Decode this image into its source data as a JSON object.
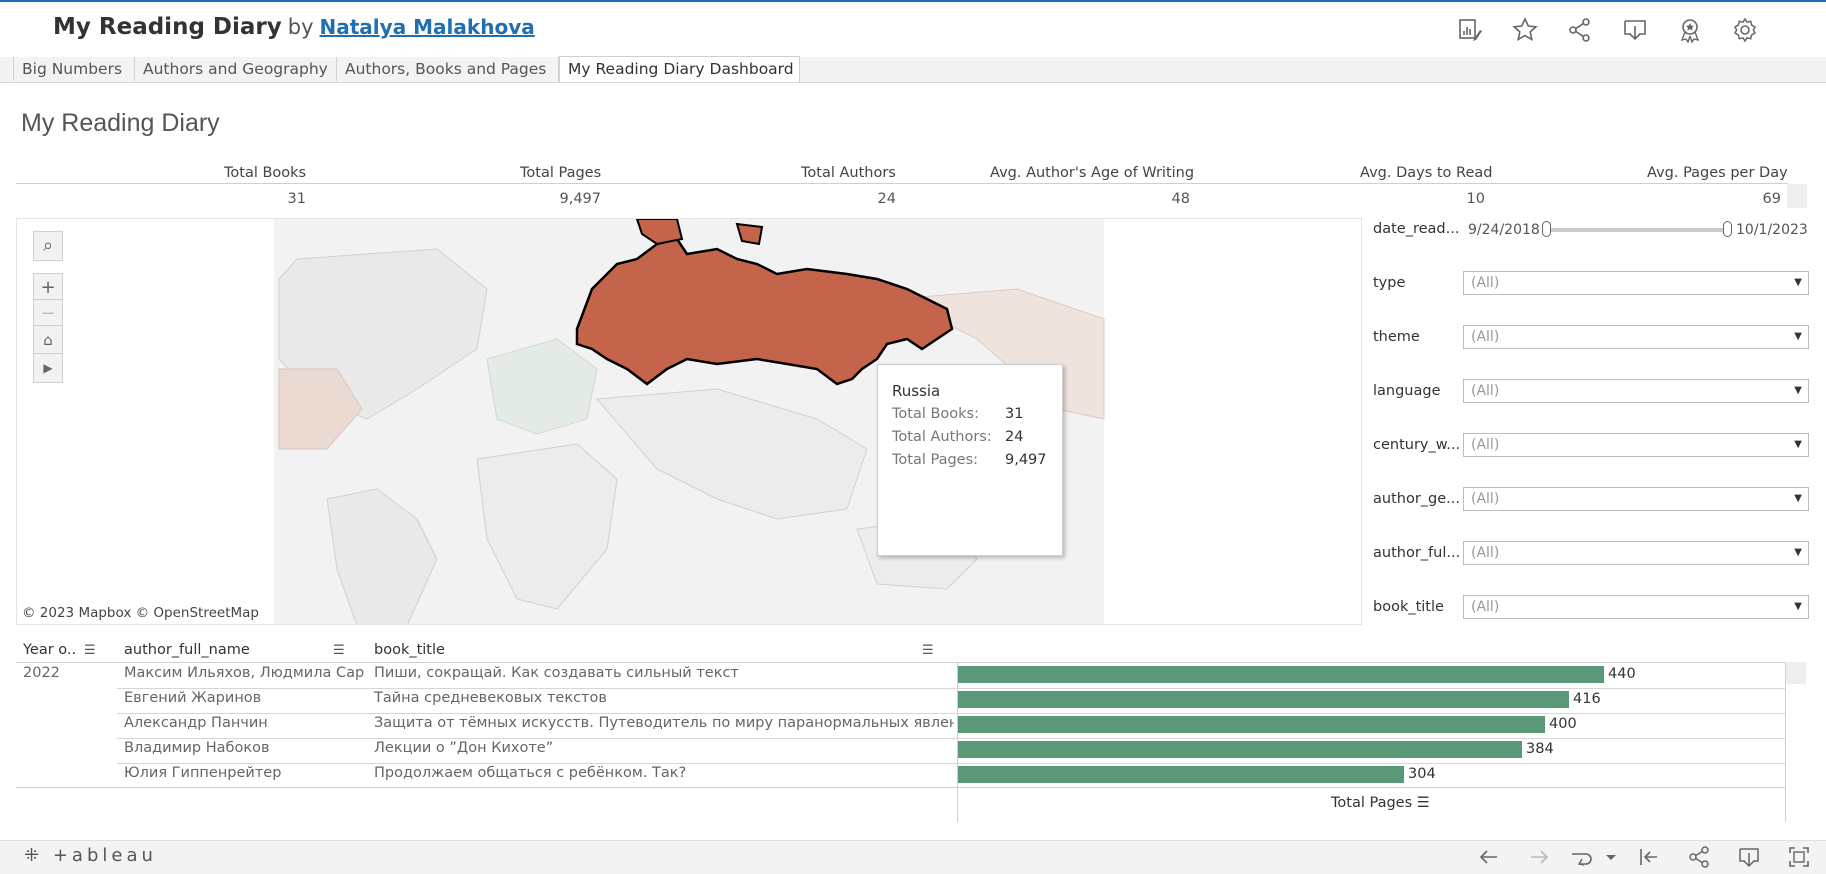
{
  "header": {
    "title": "My Reading Diary",
    "by": "by",
    "author_link": "Natalya Malakhova"
  },
  "tabs": [
    {
      "label": "Big Numbers"
    },
    {
      "label": "Authors and Geography"
    },
    {
      "label": "Authors, Books and Pages"
    },
    {
      "label": "My Reading Diary Dashboard"
    }
  ],
  "active_tab": "My Reading Diary Dashboard",
  "dashboard": {
    "title": "My Reading Diary",
    "kpis": [
      {
        "label": "Total Books",
        "value": "31"
      },
      {
        "label": "Total Pages",
        "value": "9,497"
      },
      {
        "label": "Total Authors",
        "value": "24"
      },
      {
        "label": "Avg. Author's Age of Writing",
        "value": "48"
      },
      {
        "label": "Avg. Days to Read",
        "value": "10"
      },
      {
        "label": "Avg. Pages per Day",
        "value": "69"
      }
    ]
  },
  "map": {
    "copyright": "© 2023 Mapbox  © OpenStreetMap",
    "highlight_color": "#c4644a",
    "tooltip": {
      "country": "Russia",
      "rows": [
        {
          "label": "Total Books:",
          "value": "31"
        },
        {
          "label": "Total Authors:",
          "value": "24"
        },
        {
          "label": "Total Pages:",
          "value": "9,497"
        }
      ]
    }
  },
  "filters": {
    "date_label": "date_read...",
    "date_min": "9/24/2018",
    "date_max": "10/1/2023",
    "dropdowns": [
      {
        "label": "type",
        "value": "(All)"
      },
      {
        "label": "theme",
        "value": "(All)"
      },
      {
        "label": "language",
        "value": "(All)"
      },
      {
        "label": "century_w...",
        "value": "(All)"
      },
      {
        "label": "author_ge...",
        "value": "(All)"
      },
      {
        "label": "author_ful...",
        "value": "(All)"
      },
      {
        "label": "book_title",
        "value": "(All)"
      }
    ]
  },
  "table": {
    "headers": {
      "year": "Year o..",
      "author": "author_full_name",
      "book": "book_title"
    },
    "year": "2022",
    "rows": [
      {
        "author": "Максим Ильяхов, Людмила Сар..",
        "book": "Пиши, сокращай. Как создавать сильный текст",
        "pages": 440
      },
      {
        "author": "Евгений Жаринов",
        "book": "Тайна средневековых текстов",
        "pages": 416
      },
      {
        "author": "Александр Панчин",
        "book": "Защита от тёмных искусств. Путеводитель по миру паранормальных явлений",
        "pages": 400
      },
      {
        "author": "Владимир Набоков",
        "book": "Лекции о ”Дон Кихоте”",
        "pages": 384
      },
      {
        "author": "Юлия Гиппенрейтер",
        "book": "Продолжаем общаться с ребёнком. Так?",
        "pages": 304
      }
    ],
    "axis_title": "Total Pages",
    "bar_color": "#5a9878"
  },
  "chart_data": {
    "type": "bar",
    "categories": [
      "Пиши, сокращай. Как создавать сильный текст",
      "Тайна средневековых текстов",
      "Защита от тёмных искусств. Путеводитель по миру паранормальных явлений",
      "Лекции о ”Дон Кихоте”",
      "Продолжаем общаться с ребёнком. Так?"
    ],
    "values": [
      440,
      416,
      400,
      384,
      304
    ],
    "xlabel": "Total Pages",
    "orientation": "horizontal"
  },
  "footer": {
    "logo": "+ableau"
  }
}
